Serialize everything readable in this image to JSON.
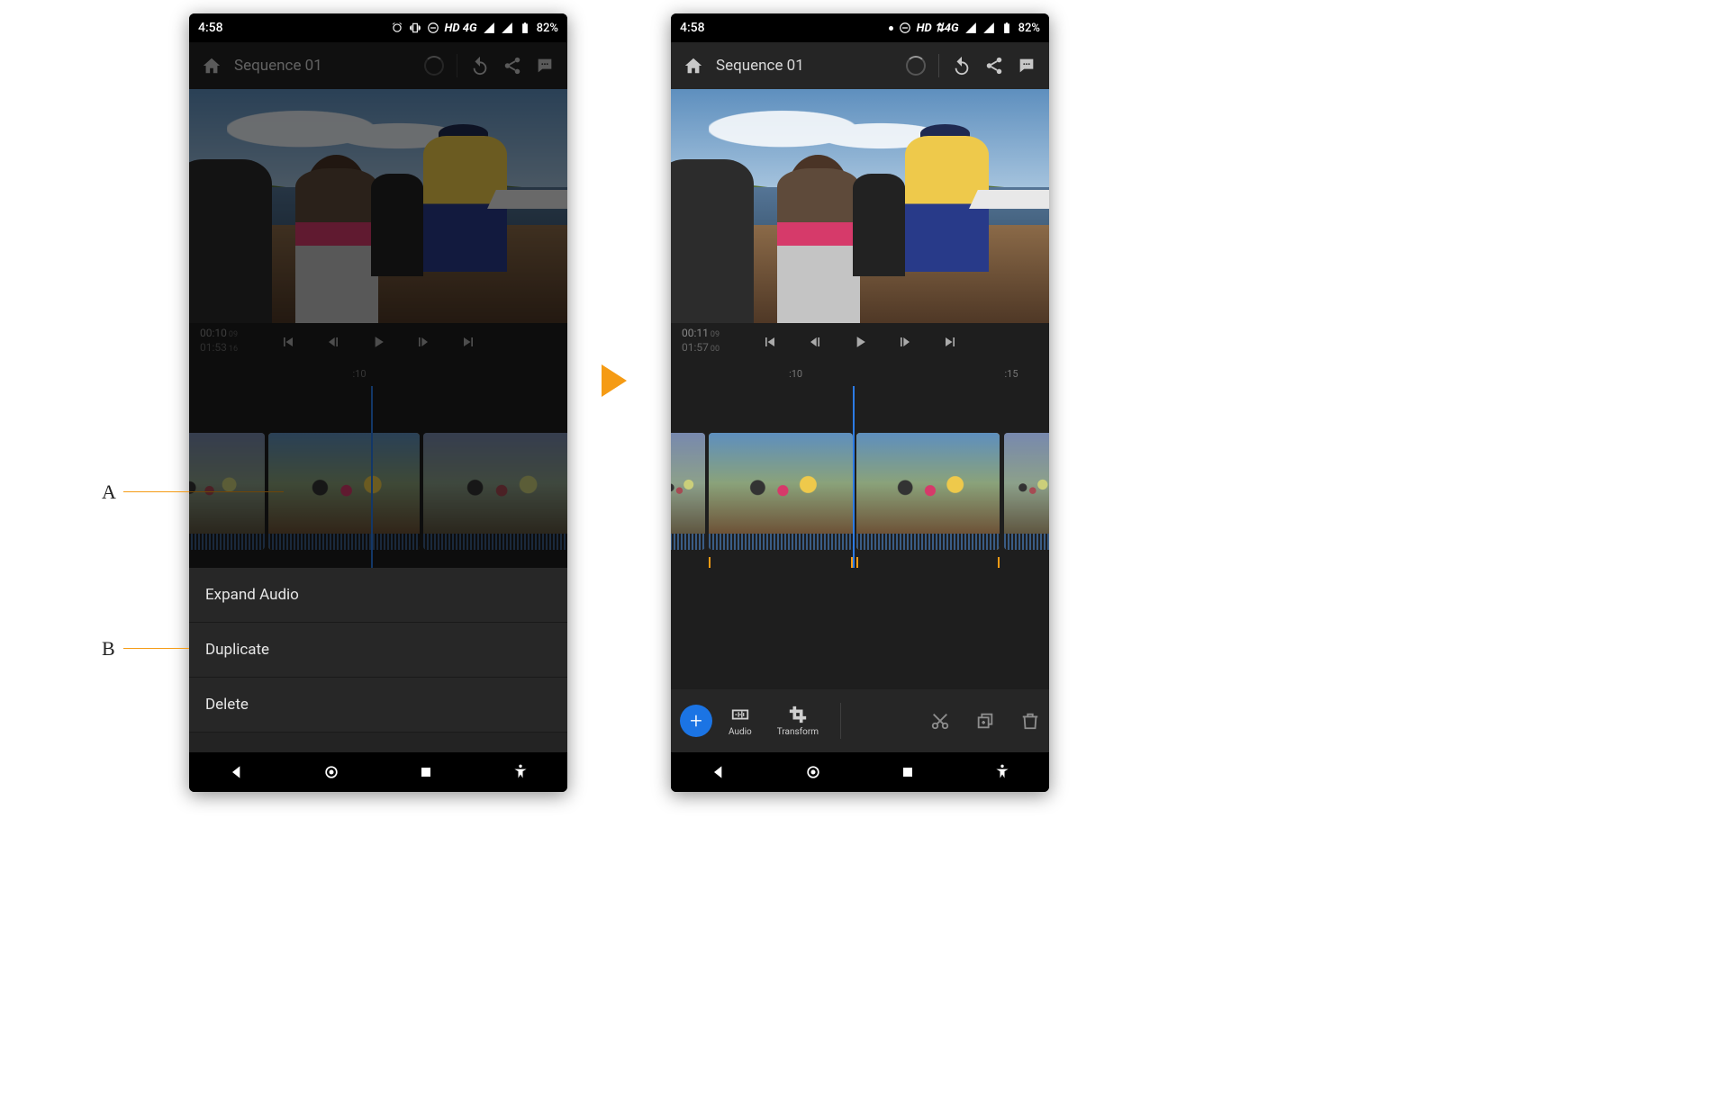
{
  "status": {
    "time": "4:58",
    "network_label": "HD 4G",
    "network_label_right": "HD ⇅4G",
    "battery_text": "82%"
  },
  "toolbar": {
    "title": "Sequence 01"
  },
  "playback_left": {
    "current_time": "00:10",
    "current_frame": "09",
    "total_time": "01:53",
    "total_frame": "16"
  },
  "playback_right": {
    "current_time": "00:11",
    "current_frame": "09",
    "total_time": "01:57",
    "total_frame": "00"
  },
  "ruler_left": {
    "tick1": ":10"
  },
  "ruler_right": {
    "tick1": ":10",
    "tick2": ":15"
  },
  "context_menu": {
    "item1": "Expand Audio",
    "item2": "Duplicate",
    "item3": "Delete"
  },
  "edit_toolbar": {
    "audio_label": "Audio",
    "transform_label": "Transform"
  },
  "callouts": {
    "A": "A",
    "B": "B"
  },
  "colors": {
    "accent_orange": "#f59b14",
    "accent_blue": "#1b74e4",
    "playhead_blue": "#2c7be5"
  }
}
